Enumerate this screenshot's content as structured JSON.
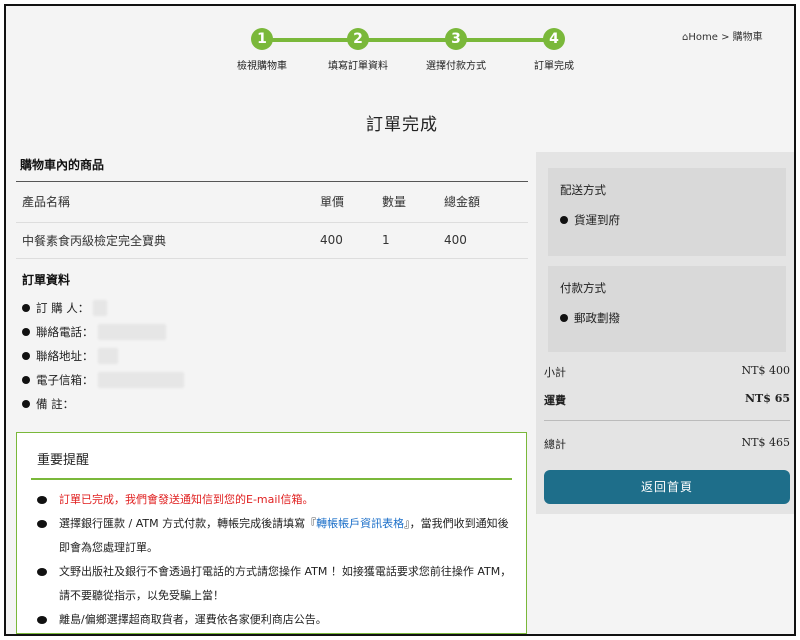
{
  "steps": [
    {
      "num": "1",
      "label": "檢視購物車"
    },
    {
      "num": "2",
      "label": "填寫訂單資料"
    },
    {
      "num": "3",
      "label": "選擇付款方式"
    },
    {
      "num": "4",
      "label": "訂單完成"
    }
  ],
  "breadcrumb": {
    "home": "Home",
    "sep": ">",
    "current": "購物車"
  },
  "page_title": "訂單完成",
  "cart": {
    "section_title": "購物車內的商品",
    "headers": {
      "name": "產品名稱",
      "price": "單價",
      "qty": "數量",
      "total": "總金額"
    },
    "rows": [
      {
        "name": "中餐素食丙級檢定完全寶典",
        "price": "400",
        "qty": "1",
        "total": "400"
      }
    ]
  },
  "order_info": {
    "title": "訂單資料",
    "buyer_label": "訂 購 人：",
    "phone_label": "聯絡電話：",
    "address_label": "聯絡地址：",
    "email_label": "電子信箱：",
    "note_label": "備 註："
  },
  "notice": {
    "title": "重要提醒",
    "item1": "訂單已完成，我們會發送通知信到您的E-mail信箱。",
    "item2_pre": "選擇銀行匯款 / ATM 方式付款，轉帳完成後請填寫『",
    "item2_link": "轉帳帳戶資訊表格",
    "item2_post": "』，當我們收到通知後即會為您處理訂單。",
    "item3": "文野出版社及銀行不會透過打電話的方式請您操作 ATM ！如接獲電話要求您前往操作 ATM，請不要聽從指示，以免受騙上當！",
    "item4": "離島/偏鄉選擇超商取貨者，運費依各家便利商店公告。"
  },
  "shipping": {
    "title": "配送方式",
    "value": "貨運到府"
  },
  "payment": {
    "title": "付款方式",
    "value": "郵政劃撥"
  },
  "summary": {
    "subtotal_label": "小計",
    "subtotal_value": "NT$ 400",
    "shipping_label": "運費",
    "shipping_value": "NT$ 65",
    "total_label": "總計",
    "total_value": "NT$ 465"
  },
  "home_button": "返回首頁",
  "colors": {
    "accent": "#7ab83a",
    "button": "#1e6e8a",
    "alert": "#e02020",
    "link": "#1a6ec8"
  }
}
